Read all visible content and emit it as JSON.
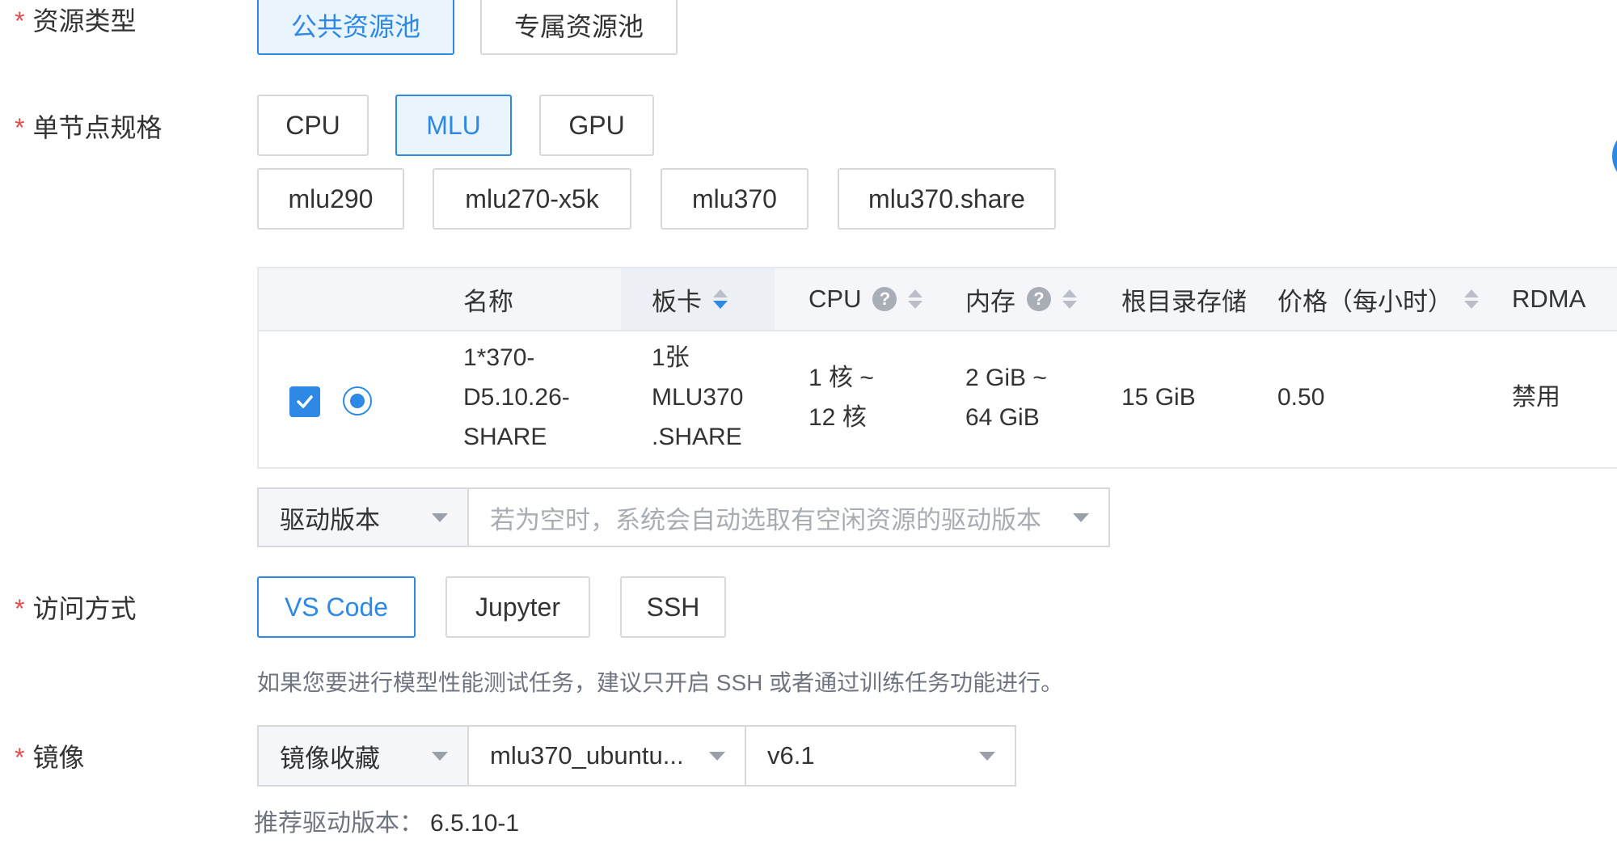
{
  "resource_type": {
    "label": "资源类型",
    "options": [
      "公共资源池",
      "专属资源池"
    ],
    "selected": "公共资源池"
  },
  "node_spec": {
    "label": "单节点规格",
    "categories": [
      "CPU",
      "MLU",
      "GPU"
    ],
    "selected_category": "MLU",
    "models": [
      "mlu290",
      "mlu270-x5k",
      "mlu370",
      "mlu370.share"
    ]
  },
  "table": {
    "headers": {
      "name": "名称",
      "card": "板卡",
      "cpu": "CPU",
      "memory": "内存",
      "root_storage": "根目录存储",
      "price": "价格（每小时）",
      "rdma": "RDMA"
    },
    "help_icon": "?",
    "rows": [
      {
        "name_lines": [
          "1*370-",
          "D5.10.26-",
          "SHARE"
        ],
        "card_lines": [
          "1张",
          "MLU370",
          ".SHARE"
        ],
        "cpu_lines": [
          "1 核 ~",
          "12 核"
        ],
        "memory_lines": [
          "2 GiB ~",
          "64 GiB"
        ],
        "root_storage": "15 GiB",
        "price": "0.50",
        "rdma": "禁用",
        "checked": true,
        "radio_selected": true
      }
    ]
  },
  "driver": {
    "type_label": "驱动版本",
    "placeholder": "若为空时，系统会自动选取有空闲资源的驱动版本"
  },
  "access": {
    "label": "访问方式",
    "options": [
      "VS Code",
      "Jupyter",
      "SSH"
    ],
    "selected": "VS Code",
    "hint": "如果您要进行模型性能测试任务，建议只开启 SSH 或者通过训练任务功能进行。"
  },
  "image": {
    "label": "镜像",
    "source": "镜像收藏",
    "name": "mlu370_ubuntu...",
    "version": "v6.1",
    "recommend_label": "推荐驱动版本：",
    "recommend_value": "6.5.10-1"
  },
  "colors": {
    "accent": "#2e89e4",
    "required": "#e44c4c",
    "border": "#d8d8d8"
  },
  "icons": {
    "required_mark": "*",
    "check": "check-icon",
    "caret": "caret-down-icon",
    "sort": "sort-icon",
    "help": "question-circle-icon"
  }
}
